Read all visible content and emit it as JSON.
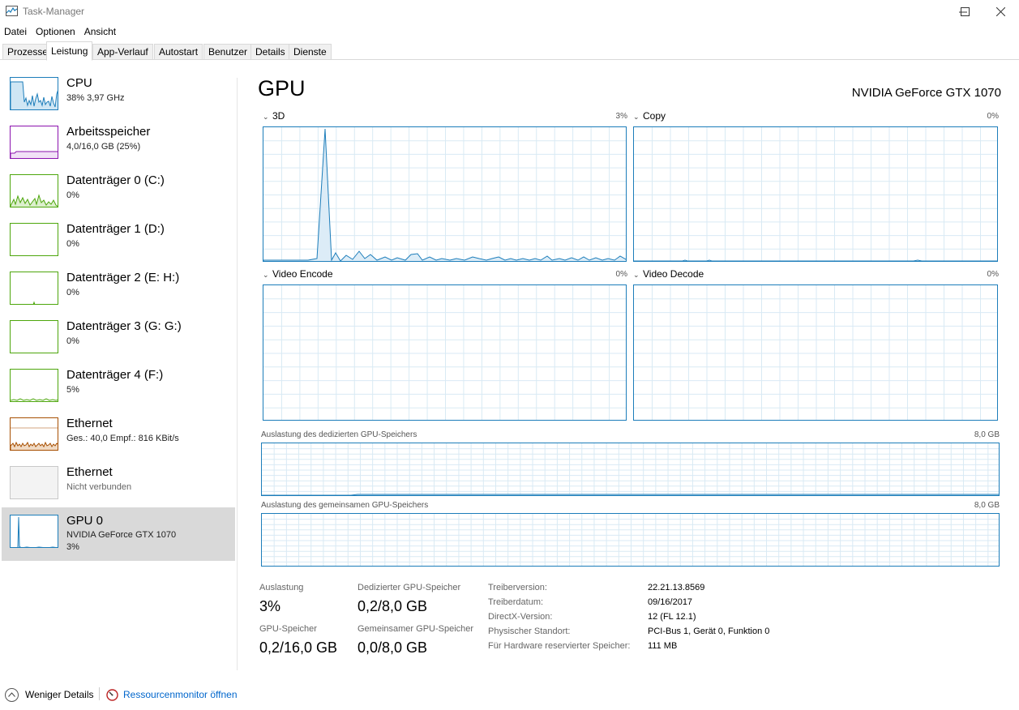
{
  "window": {
    "title": "Task-Manager"
  },
  "menu": [
    "Datei",
    "Optionen",
    "Ansicht"
  ],
  "tabs": [
    {
      "label": "Prozesse",
      "active": false
    },
    {
      "label": "Leistung",
      "active": true
    },
    {
      "label": "App-Verlauf",
      "active": false
    },
    {
      "label": "Autostart",
      "active": false
    },
    {
      "label": "Benutzer",
      "active": false
    },
    {
      "label": "Details",
      "active": false
    },
    {
      "label": "Dienste",
      "active": false
    }
  ],
  "sidebar": {
    "items": [
      {
        "name": "CPU",
        "sub": "38%  3,97 GHz",
        "sub2": "",
        "color": "#1c7dba",
        "selected": false
      },
      {
        "name": "Arbeitsspeicher",
        "sub": "4,0/16,0 GB (25%)",
        "sub2": "",
        "color": "#8b12ae",
        "selected": false
      },
      {
        "name": "Datenträger 0 (C:)",
        "sub": "0%",
        "sub2": "",
        "color": "#4da60c",
        "selected": false
      },
      {
        "name": "Datenträger 1 (D:)",
        "sub": "0%",
        "sub2": "",
        "color": "#4da60c",
        "selected": false
      },
      {
        "name": "Datenträger 2 (E: H:)",
        "sub": "0%",
        "sub2": "",
        "color": "#4da60c",
        "selected": false
      },
      {
        "name": "Datenträger 3 (G: G:)",
        "sub": "0%",
        "sub2": "",
        "color": "#4da60c",
        "selected": false
      },
      {
        "name": "Datenträger 4 (F:)",
        "sub": "5%",
        "sub2": "",
        "color": "#4da60c",
        "selected": false
      },
      {
        "name": "Ethernet",
        "sub": "Ges.: 40,0  Empf.: 816 KBit/s",
        "sub2": "",
        "color": "#a74f01",
        "selected": false
      },
      {
        "name": "Ethernet",
        "sub": "Nicht verbunden",
        "sub2": "",
        "color": "#c8c8c8",
        "selected": false
      },
      {
        "name": "GPU 0",
        "sub": "NVIDIA GeForce GTX 1070",
        "sub2": "3%",
        "color": "#1c7dba",
        "selected": true
      }
    ]
  },
  "main": {
    "title": "GPU",
    "device": "NVIDIA GeForce GTX 1070",
    "engines": [
      {
        "label": "3D",
        "value": "3%"
      },
      {
        "label": "Copy",
        "value": "0%"
      },
      {
        "label": "Video Encode",
        "value": "0%"
      },
      {
        "label": "Video Decode",
        "value": "0%"
      }
    ],
    "dedicated_label": "Auslastung des dedizierten GPU-Speichers",
    "dedicated_max": "8,0 GB",
    "shared_label": "Auslastung des gemeinsamen GPU-Speichers",
    "shared_max": "8,0 GB",
    "stats": {
      "utilization_label": "Auslastung",
      "utilization_value": "3%",
      "dedicated_label": "Dedizierter GPU-Speicher",
      "dedicated_value": "0,2/8,0 GB",
      "gpu_memory_label": "GPU-Speicher",
      "gpu_memory_value": "0,2/16,0 GB",
      "shared_label": "Gemeinsamer GPU-Speicher",
      "shared_value": "0,0/8,0 GB"
    },
    "info": [
      {
        "label": "Treiberversion:",
        "value": "22.21.13.8569"
      },
      {
        "label": "Treiberdatum:",
        "value": "09/16/2017"
      },
      {
        "label": "DirectX-Version:",
        "value": "12 (FL 12.1)"
      },
      {
        "label": "Physischer Standort:",
        "value": "PCI-Bus 1, Gerät 0, Funktion 0"
      },
      {
        "label": "Für Hardware reservierter Speicher:",
        "value": "111 MB"
      }
    ]
  },
  "footer": {
    "fewer_details": "Weniger Details",
    "resource_monitor": "Ressourcenmonitor öffnen"
  },
  "colors": {
    "gpu_line": "#1c7dba",
    "grid": "#d9eaf4",
    "selected_bg": "#d9d9d9"
  }
}
